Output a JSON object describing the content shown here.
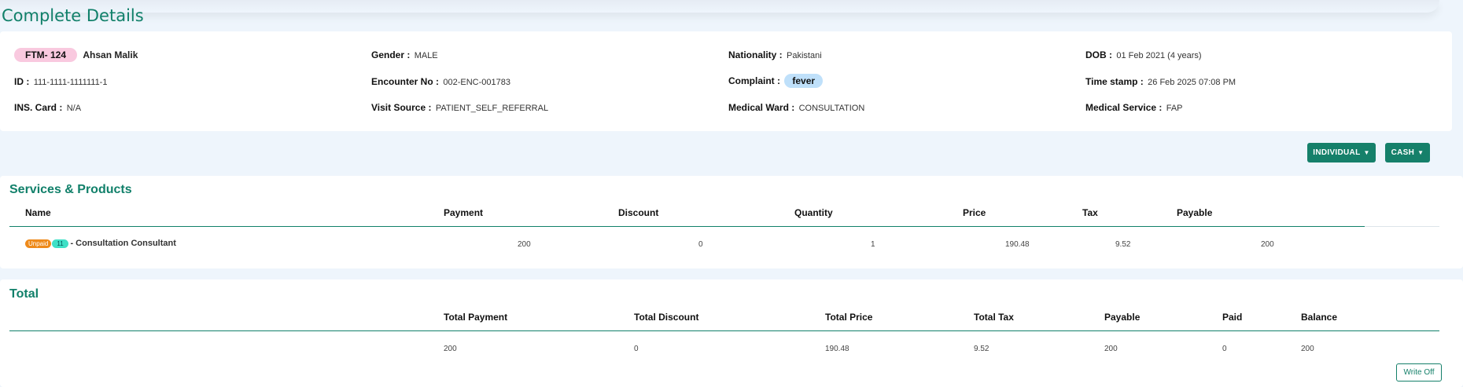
{
  "page": {
    "title": "Complete Details"
  },
  "details": {
    "patient_code": "FTM- 124",
    "patient_name": "Ahsan Malik",
    "gender_label": "Gender :",
    "gender": "MALE",
    "nationality_label": "Nationality :",
    "nationality": "Pakistani",
    "dob_label": "DOB :",
    "dob": "01 Feb 2021 (4 years)",
    "id_label": "ID :",
    "id": "111-1111-1111111-1",
    "encounter_label": "Encounter No :",
    "encounter": "002-ENC-001783",
    "complaint_label": "Complaint :",
    "complaint": "fever",
    "timestamp_label": "Time stamp :",
    "timestamp": "26 Feb 2025 07:08 PM",
    "ins_label": "INS. Card :",
    "ins": "N/A",
    "visit_source_label": "Visit Source :",
    "visit_source": "PATIENT_SELF_REFERRAL",
    "ward_label": "Medical Ward :",
    "ward": "CONSULTATION",
    "service_label": "Medical Service :",
    "service": "FAP"
  },
  "actions": {
    "individual": "INDIVIDUAL",
    "cash": "CASH",
    "write_off": "Write Off"
  },
  "services": {
    "title": "Services & Products",
    "headers": {
      "name": "Name",
      "payment": "Payment",
      "discount": "Discount",
      "quantity": "Quantity",
      "price": "Price",
      "tax": "Tax",
      "payable": "Payable"
    },
    "rows": [
      {
        "status": "Unpaid",
        "code": "11",
        "name": "- Consultation Consultant",
        "payment": "200",
        "discount": "0",
        "quantity": "1",
        "price": "190.48",
        "tax": "9.52",
        "payable": "200"
      }
    ]
  },
  "total": {
    "title": "Total",
    "headers": {
      "total_payment": "Total Payment",
      "total_discount": "Total Discount",
      "total_price": "Total Price",
      "total_tax": "Total Tax",
      "payable": "Payable",
      "paid": "Paid",
      "balance": "Balance"
    },
    "values": {
      "total_payment": "200",
      "total_discount": "0",
      "total_price": "190.48",
      "total_tax": "9.52",
      "payable": "200",
      "paid": "0",
      "balance": "200"
    }
  },
  "colors": {
    "accent": "#15806a",
    "background": "#eef5fc",
    "unpaid": "#ee8a1a",
    "code_badge": "#3ee0c6"
  }
}
